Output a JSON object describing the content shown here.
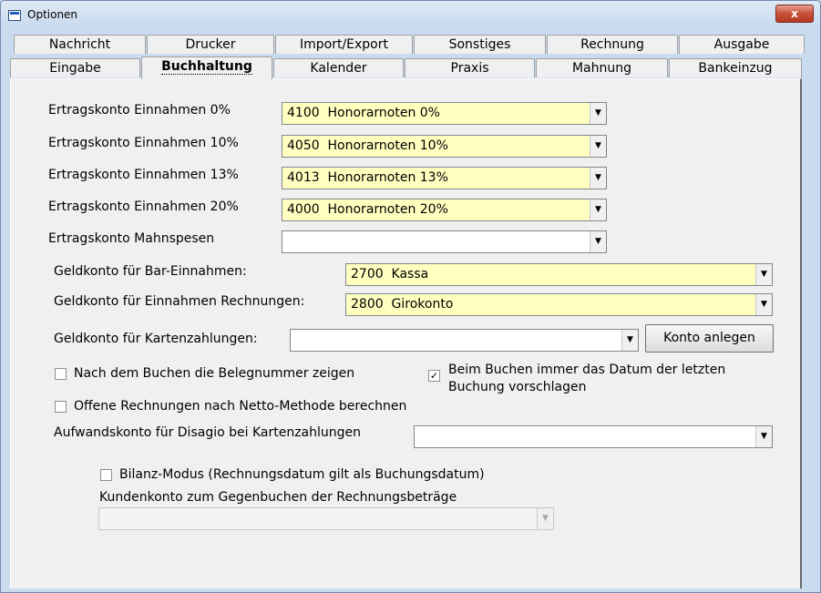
{
  "window": {
    "title": "Optionen",
    "close_label": "x"
  },
  "tabs_row1": [
    "Nachricht",
    "Drucker",
    "Import/Export",
    "Sonstiges",
    "Rechnung",
    "Ausgabe"
  ],
  "tabs_row2": [
    "Eingabe",
    "Buchhaltung",
    "Kalender",
    "Praxis",
    "Mahnung",
    "Bankeinzug"
  ],
  "active_tab": "Buchhaltung",
  "fields": {
    "ertrag0": {
      "label": "Ertragskonto Einnahmen 0%",
      "value": "4100  Honorarnoten 0%"
    },
    "ertrag10": {
      "label": "Ertragskonto Einnahmen 10%",
      "value": "4050  Honorarnoten 10%"
    },
    "ertrag13": {
      "label": "Ertragskonto Einnahmen 13%",
      "value": "4013  Honorarnoten 13%"
    },
    "ertrag20": {
      "label": "Ertragskonto Einnahmen 20%",
      "value": "4000  Honorarnoten 20%"
    },
    "mahnspesen": {
      "label": "Ertragskonto Mahnspesen",
      "value": ""
    },
    "bar": {
      "label": "Geldkonto für Bar-Einnahmen:",
      "value": "2700  Kassa"
    },
    "rechnungen": {
      "label": "Geldkonto für Einnahmen Rechnungen:",
      "value": "2800  Girokonto"
    },
    "karten": {
      "label": "Geldkonto für Kartenzahlungen:",
      "value": ""
    },
    "disagio": {
      "label": "Aufwandskonto für Disagio bei Kartenzahlungen",
      "value": ""
    },
    "kundenkonto": {
      "label": "Kundenkonto zum Gegenbuchen der Rechnungsbeträge",
      "value": ""
    }
  },
  "buttons": {
    "konto_anlegen": "Konto anlegen"
  },
  "checkboxes": {
    "belegnummer": {
      "label": "Nach dem Buchen die Belegnummer zeigen",
      "checked": false
    },
    "datum_line1": "Beim Buchen immer das Datum der letzten",
    "datum_line2": "Buchung vorschlagen",
    "datum_checked": true,
    "netto": {
      "label": "Offene Rechnungen nach Netto-Methode berechnen",
      "checked": false
    },
    "bilanz": {
      "label": "Bilanz-Modus (Rechnungsdatum gilt als Buchungsdatum)",
      "checked": false
    }
  },
  "glyphs": {
    "check": "✓",
    "arrow": "▼"
  },
  "colors": {
    "highlight_field": "#ffffc0",
    "close_button": "#c75038"
  }
}
